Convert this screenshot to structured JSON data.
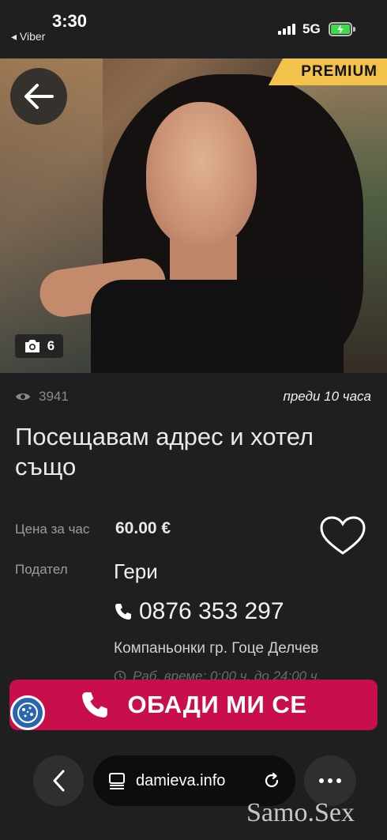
{
  "status_bar": {
    "time": "3:30",
    "back_app": "◂ Viber",
    "network": "5G",
    "battery_color": "#3ddc4a"
  },
  "listing": {
    "premium_badge": "PREMIUM",
    "photo_count": "6",
    "views": "3941",
    "posted": "преди 10 часа",
    "title": "Посещавам адрес и хотел също",
    "price_label": "Цена за час",
    "price_value": "60.00 €",
    "seller_label": "Подател",
    "seller_name": "Гери",
    "phone": "0876 353 297",
    "category": "Компаньонки гр. Гоце Делчев",
    "hours": "Раб. време: 0:00 ч. до 24:00 ч."
  },
  "call_button": {
    "label": "ОБАДИ МИ СЕ",
    "color": "#c80f4c"
  },
  "browser": {
    "url": "damieva.info"
  },
  "watermark": "Samo.Sex",
  "icons": {
    "back": "arrow-left-icon",
    "camera": "camera-icon",
    "eye": "eye-icon",
    "heart": "heart-icon",
    "phone": "phone-icon",
    "clock": "clock-icon",
    "reload": "reload-icon",
    "more": "more-icon",
    "cookie": "cookie-icon"
  },
  "accent_colors": {
    "premium": "#f2c24a",
    "background": "#1f1f21"
  }
}
